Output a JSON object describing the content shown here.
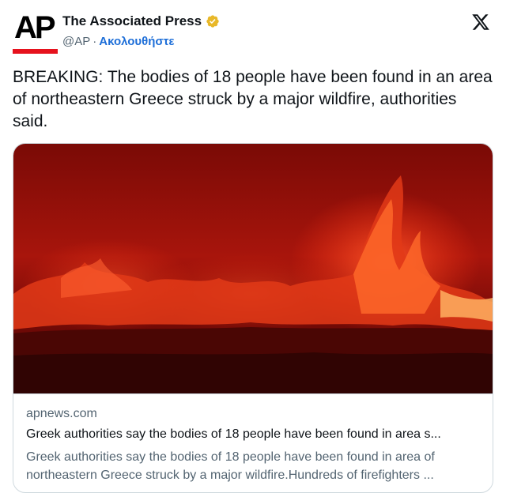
{
  "author": {
    "display_name": "The Associated Press",
    "handle": "@AP",
    "separator": "·",
    "follow_label": "Ακολουθήστε",
    "avatar_logo_text": "AP",
    "verified_color": "#e8b829"
  },
  "platform_icon": "x-logo-icon",
  "tweet": {
    "text": "BREAKING: The bodies of 18 people have been found in an area of northeastern Greece struck by a major wildfire, authorities said."
  },
  "link_card": {
    "domain": "apnews.com",
    "title": "Greek authorities say the bodies of 18 people have been found in area s...",
    "description": "Greek authorities say the bodies of 18 people have been found in area of northeastern Greece struck by a major wildfire.Hundreds of firefighters ...",
    "image_subject": "wildfire-flames-at-night"
  },
  "colors": {
    "link_blue": "#1d6ed8",
    "ap_red": "#e6121d",
    "secondary_text": "#536471",
    "border": "#cfd9de"
  }
}
